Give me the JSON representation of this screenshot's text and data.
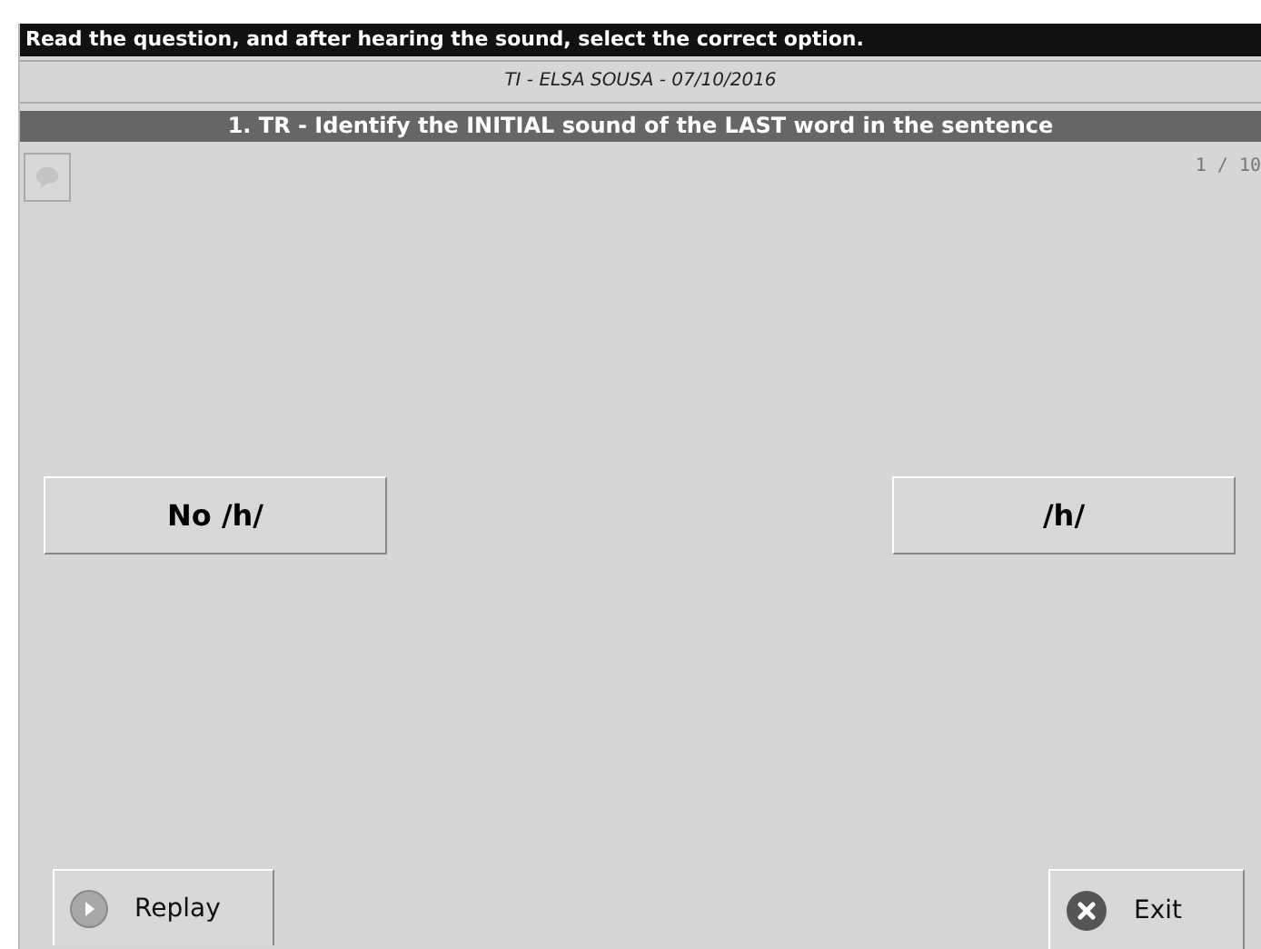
{
  "instruction": "Read the question, and after hearing the sound, select the correct option.",
  "session": "TI - ELSA SOUSA - 07/10/2016",
  "question_title": "1. TR - Identify the INITIAL sound of the LAST word in the sentence",
  "progress": "1 / 10",
  "options": [
    {
      "label": "No /h/"
    },
    {
      "label": "/h/"
    }
  ],
  "actions": [
    {
      "kind": "replay",
      "label": "Replay"
    },
    {
      "kind": "exit",
      "label": "Exit"
    }
  ]
}
